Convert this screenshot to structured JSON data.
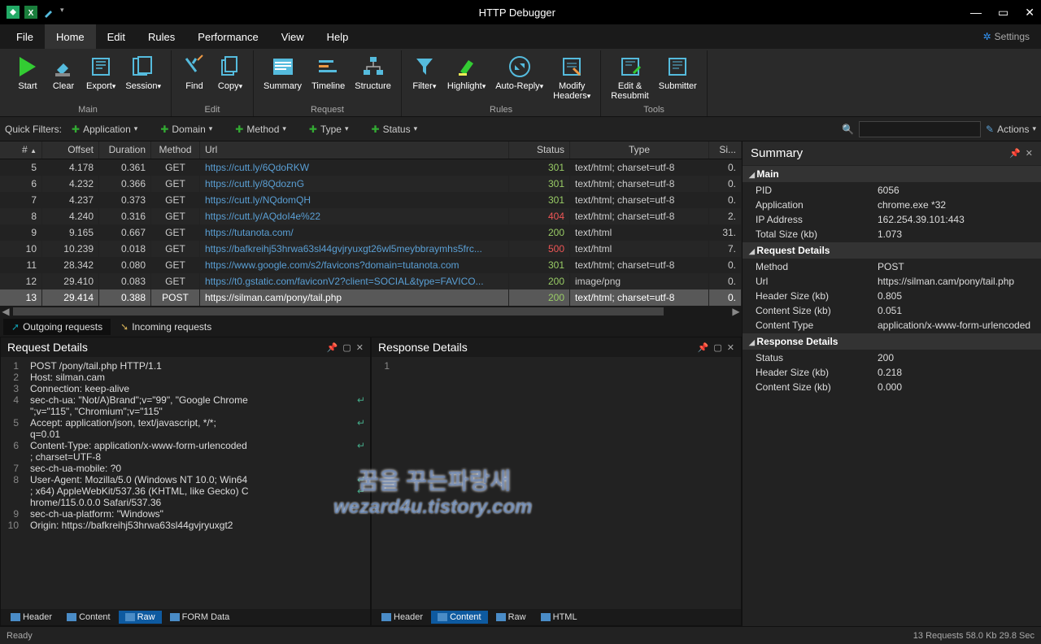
{
  "window": {
    "title": "HTTP Debugger"
  },
  "menubar": {
    "items": [
      {
        "label": "File",
        "active": false
      },
      {
        "label": "Home",
        "active": true
      },
      {
        "label": "Edit",
        "active": false
      },
      {
        "label": "Rules",
        "active": false
      },
      {
        "label": "Performance",
        "active": false
      },
      {
        "label": "View",
        "active": false
      },
      {
        "label": "Help",
        "active": false
      }
    ],
    "settings": "Settings"
  },
  "ribbon": {
    "groups": [
      {
        "label": "Main",
        "buttons": [
          {
            "name": "start",
            "label": "Start",
            "dropdown": false
          },
          {
            "name": "clear",
            "label": "Clear",
            "dropdown": false
          },
          {
            "name": "export",
            "label": "Export",
            "dropdown": true
          },
          {
            "name": "session",
            "label": "Session",
            "dropdown": true
          }
        ]
      },
      {
        "label": "Edit",
        "buttons": [
          {
            "name": "find",
            "label": "Find",
            "dropdown": false
          },
          {
            "name": "copy",
            "label": "Copy",
            "dropdown": true
          }
        ]
      },
      {
        "label": "Request",
        "buttons": [
          {
            "name": "summary",
            "label": "Summary",
            "dropdown": false
          },
          {
            "name": "timeline",
            "label": "Timeline",
            "dropdown": false
          },
          {
            "name": "structure",
            "label": "Structure",
            "dropdown": false
          }
        ]
      },
      {
        "label": "Rules",
        "buttons": [
          {
            "name": "filter",
            "label": "Filter",
            "dropdown": true
          },
          {
            "name": "highlight",
            "label": "Highlight",
            "dropdown": true
          },
          {
            "name": "autoreply",
            "label": "Auto-Reply",
            "dropdown": true
          },
          {
            "name": "modifyheaders",
            "label": "Modify\nHeaders",
            "dropdown": true
          }
        ]
      },
      {
        "label": "Tools",
        "buttons": [
          {
            "name": "editresubmit",
            "label": "Edit &\nResubmit",
            "dropdown": false
          },
          {
            "name": "submitter",
            "label": "Submitter",
            "dropdown": false
          }
        ]
      }
    ]
  },
  "quickfilters": {
    "label": "Quick Filters:",
    "items": [
      "Application",
      "Domain",
      "Method",
      "Type",
      "Status"
    ],
    "actions": "Actions"
  },
  "grid": {
    "headers": [
      "#",
      "Offset",
      "Duration",
      "Method",
      "Url",
      "Status",
      "Type",
      "Si..."
    ],
    "rows": [
      {
        "n": "5",
        "offset": "4.178",
        "dur": "0.361",
        "method": "GET",
        "url": "https://cutt.ly/6QdoRKW",
        "status": "301",
        "type": "text/html; charset=utf-8",
        "size": "0."
      },
      {
        "n": "6",
        "offset": "4.232",
        "dur": "0.366",
        "method": "GET",
        "url": "https://cutt.ly/8QdoznG",
        "status": "301",
        "type": "text/html; charset=utf-8",
        "size": "0."
      },
      {
        "n": "7",
        "offset": "4.237",
        "dur": "0.373",
        "method": "GET",
        "url": "https://cutt.ly/NQdomQH",
        "status": "301",
        "type": "text/html; charset=utf-8",
        "size": "0."
      },
      {
        "n": "8",
        "offset": "4.240",
        "dur": "0.316",
        "method": "GET",
        "url": "https://cutt.ly/AQdoI4e%22",
        "status": "404",
        "type": "text/html; charset=utf-8",
        "size": "2."
      },
      {
        "n": "9",
        "offset": "9.165",
        "dur": "0.667",
        "method": "GET",
        "url": "https://tutanota.com/",
        "status": "200",
        "type": "text/html",
        "size": "31."
      },
      {
        "n": "10",
        "offset": "10.239",
        "dur": "0.018",
        "method": "GET",
        "url": "https://bafkreihj53hrwa63sl44gvjryuxgt26wl5meybbraymhs5frc...",
        "status": "500",
        "type": "text/html",
        "size": "7."
      },
      {
        "n": "11",
        "offset": "28.342",
        "dur": "0.080",
        "method": "GET",
        "url": "https://www.google.com/s2/favicons?domain=tutanota.com",
        "status": "301",
        "type": "text/html; charset=utf-8",
        "size": "0."
      },
      {
        "n": "12",
        "offset": "29.410",
        "dur": "0.083",
        "method": "GET",
        "url": "https://t0.gstatic.com/faviconV2?client=SOCIAL&type=FAVICO...",
        "status": "200",
        "type": "image/png",
        "size": "0."
      },
      {
        "n": "13",
        "offset": "29.414",
        "dur": "0.388",
        "method": "POST",
        "url": "https://silman.cam/pony/tail.php",
        "status": "200",
        "type": "text/html; charset=utf-8",
        "size": "0.",
        "selected": true,
        "plain": true
      }
    ]
  },
  "reqtabs": {
    "outgoing": "Outgoing requests",
    "incoming": "Incoming requests"
  },
  "requestDetails": {
    "title": "Request Details",
    "lines": [
      "POST /pony/tail.php HTTP/1.1",
      "Host: silman.cam",
      "Connection: keep-alive",
      "sec-ch-ua: \"Not/A)Brand\";v=\"99\", \"Google Chrome\n\";v=\"115\", \"Chromium\";v=\"115\"",
      "Accept: application/json, text/javascript, */*; \nq=0.01",
      "Content-Type: application/x-www-form-urlencoded\n; charset=UTF-8",
      "sec-ch-ua-mobile: ?0",
      "User-Agent: Mozilla/5.0 (Windows NT 10.0; Win64\n; x64) AppleWebKit/537.36 (KHTML, like Gecko) C\nhrome/115.0.0.0 Safari/537.36",
      "sec-ch-ua-platform: \"Windows\"",
      "Origin: https://bafkreihj53hrwa63sl44gvjryuxgt2"
    ],
    "tabs": [
      "Header",
      "Content",
      "Raw",
      "FORM Data"
    ],
    "activeTab": 2
  },
  "responseDetails": {
    "title": "Response Details",
    "lines": [
      ""
    ],
    "tabs": [
      "Header",
      "Content",
      "Raw",
      "HTML"
    ],
    "activeTab": 1
  },
  "summary": {
    "title": "Summary",
    "sections": [
      {
        "name": "Main",
        "rows": [
          {
            "k": "PID",
            "v": "6056"
          },
          {
            "k": "Application",
            "v": "chrome.exe *32"
          },
          {
            "k": "IP Address",
            "v": "162.254.39.101:443"
          },
          {
            "k": "Total Size (kb)",
            "v": "1.073"
          }
        ]
      },
      {
        "name": "Request Details",
        "rows": [
          {
            "k": "Method",
            "v": "POST"
          },
          {
            "k": "Url",
            "v": "https://silman.cam/pony/tail.php"
          },
          {
            "k": "Header Size (kb)",
            "v": "0.805"
          },
          {
            "k": "Content Size (kb)",
            "v": "0.051"
          },
          {
            "k": "Content Type",
            "v": "application/x-www-form-urlencoded"
          }
        ]
      },
      {
        "name": "Response Details",
        "rows": [
          {
            "k": "Status",
            "v": "200"
          },
          {
            "k": "Header Size (kb)",
            "v": "0.218"
          },
          {
            "k": "Content Size (kb)",
            "v": "0.000"
          }
        ]
      }
    ]
  },
  "statusbar": {
    "left": "Ready",
    "right": "13 Requests    58.0 Kb    29.8 Sec"
  },
  "watermark": {
    "line1": "꿈을 꾸는파랑새",
    "line2": "wezard4u.tistory.com"
  }
}
